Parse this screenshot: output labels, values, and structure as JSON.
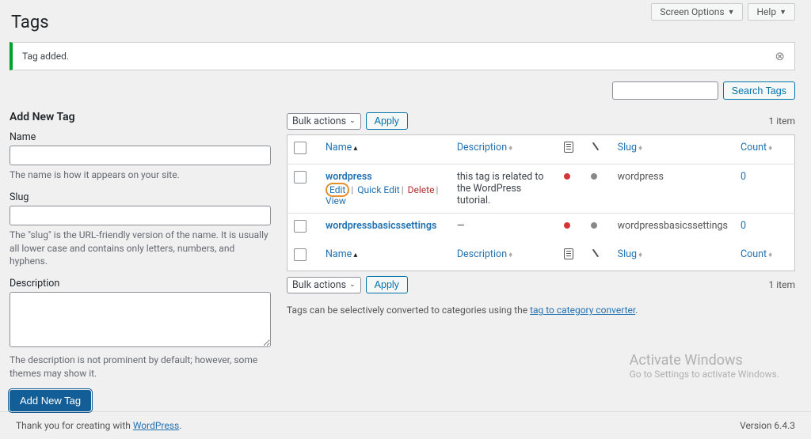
{
  "topbar": {
    "screen_options": "Screen Options",
    "help": "Help"
  },
  "page_title": "Tags",
  "notice": "Tag added.",
  "form": {
    "heading": "Add New Tag",
    "name_label": "Name",
    "name_help": "The name is how it appears on your site.",
    "slug_label": "Slug",
    "slug_help": "The \"slug\" is the URL-friendly version of the name. It is usually all lower case and contains only letters, numbers, and hyphens.",
    "desc_label": "Description",
    "desc_help": "The description is not prominent by default; however, some themes may show it.",
    "submit": "Add New Tag"
  },
  "search": {
    "button": "Search Tags"
  },
  "bulk": {
    "label": "Bulk actions",
    "apply": "Apply"
  },
  "item_count": "1 item",
  "columns": {
    "name": "Name",
    "description": "Description",
    "slug": "Slug",
    "count": "Count"
  },
  "rows": [
    {
      "name": "wordpress",
      "description": "this tag is related to the WordPress tutorial.",
      "slug": "wordpress",
      "count": "0",
      "dot1": "#d63638",
      "dot2": "#888"
    },
    {
      "name": "wordpressbasicssettings",
      "description": "—",
      "slug": "wordpressbasicssettings",
      "count": "0",
      "dot1": "#d63638",
      "dot2": "#888"
    }
  ],
  "row_actions": {
    "edit": "Edit",
    "quick_edit": "Quick Edit",
    "delete": "Delete",
    "view": "View"
  },
  "converter": {
    "pre": "Tags can be selectively converted to categories using the ",
    "link": "tag to category converter",
    "post": "."
  },
  "watermark": {
    "t1": "Activate Windows",
    "t2": "Go to Settings to activate Windows."
  },
  "footer": {
    "thank_pre": "Thank you for creating with ",
    "wp": "WordPress",
    "version": "Version 6.4.3"
  }
}
